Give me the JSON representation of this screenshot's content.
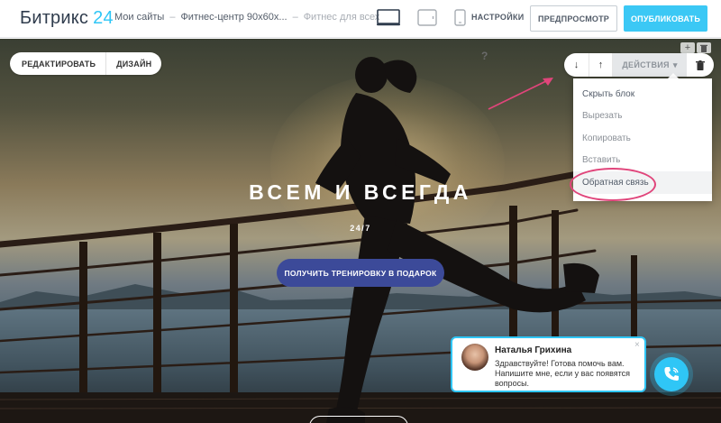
{
  "topbar": {
    "logo_text": "Битрикс",
    "logo_num": "24",
    "breadcrumbs": [
      "Мои сайты",
      "Фитнес-центр 90x60x...",
      "Фитнес для всех"
    ],
    "breadcrumb_sep": "–",
    "settings_label": "НАСТРОЙКИ",
    "preview_label": "ПРЕДПРОСМОТР",
    "publish_label": "ОПУБЛИКОВАТЬ",
    "device_icons": [
      "desktop-icon",
      "tablet-icon",
      "mobile-icon"
    ]
  },
  "editor": {
    "edit_label": "РЕДАКТИРОВАТЬ",
    "design_label": "ДИЗАЙН",
    "help_symbol": "?",
    "mini_add": "+",
    "mini_delete": "🗑"
  },
  "block_toolbar": {
    "down_symbol": "↓",
    "up_symbol": "↑",
    "actions_label": "ДЕЙСТВИЯ",
    "actions_caret": "▾"
  },
  "actions_menu": {
    "items": [
      "Скрыть блок",
      "Вырезать",
      "Копировать",
      "Вставить",
      "Обратная связь"
    ]
  },
  "hero": {
    "title": "ВСЕМ И ВСЕГДА",
    "subtitle": "24/7",
    "cta_label": "ПОЛУЧИТЬ ТРЕНИРОВКУ В ПОДАРОК"
  },
  "chat": {
    "name": "Наталья Грихина",
    "message": "Здравствуйте! Готова помочь вам. Напишите мне, если у вас появятся вопросы.",
    "close_symbol": "×"
  },
  "colors": {
    "accent": "#2fc6f6",
    "cta": "#3c4a99",
    "highlight": "#e0457b"
  }
}
